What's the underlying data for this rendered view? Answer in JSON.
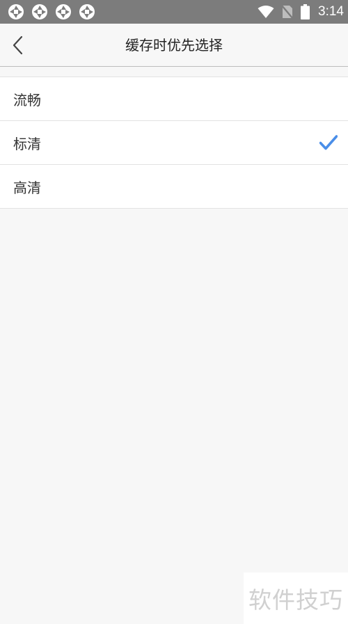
{
  "status_bar": {
    "time": "3:14",
    "notification_icons": [
      "aperture-icon",
      "aperture-icon",
      "aperture-icon",
      "aperture-icon"
    ],
    "system_icons": [
      "wifi-icon",
      "no-sim-icon",
      "battery-icon"
    ],
    "background_color": "#7c7c7c"
  },
  "nav": {
    "title": "缓存时优先选择",
    "back_icon": "chevron-left-icon"
  },
  "options": [
    {
      "label": "流畅",
      "selected": false
    },
    {
      "label": "标清",
      "selected": true
    },
    {
      "label": "高清",
      "selected": false
    }
  ],
  "accent_color": "#4a8ee8",
  "watermark": {
    "text": "软件技巧"
  }
}
